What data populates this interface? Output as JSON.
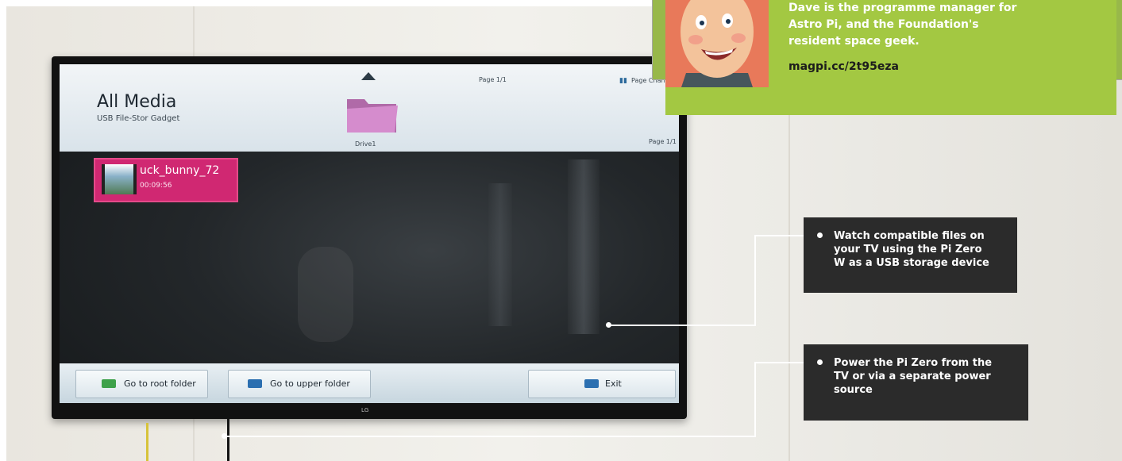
{
  "colors": {
    "accent_green": "#a3c842",
    "tile_pink": "#d02872",
    "callout_bg": "#2b2b2b",
    "root_icon": "#3ea14a",
    "upper_icon": "#2b6fb0",
    "exit_icon": "#2b6fb0"
  },
  "tv": {
    "header": {
      "title": "All Media",
      "subtitle": "USB File-Stor Gadget",
      "folder_label": "Drive1",
      "page_info_top": "Page 1/1",
      "page_change_label": "Page Change",
      "page_info_right": "Page 1/1"
    },
    "media": [
      {
        "name": "uck_bunny_72",
        "duration": "00:09:56"
      }
    ],
    "buttons": {
      "root": "Go to root folder",
      "upper": "Go to upper folder",
      "exit": "Exit"
    },
    "brand": "LG"
  },
  "callouts": [
    {
      "text": "Watch compatible files on your TV using the Pi Zero W as a USB storage device"
    },
    {
      "text": "Power the Pi Zero from the TV or via a separate power source"
    }
  ],
  "author": {
    "bio": "Dave is the programme manager for Astro Pi, and the Foundation's resident space geek.",
    "link": "magpi.cc/2t95eza"
  }
}
